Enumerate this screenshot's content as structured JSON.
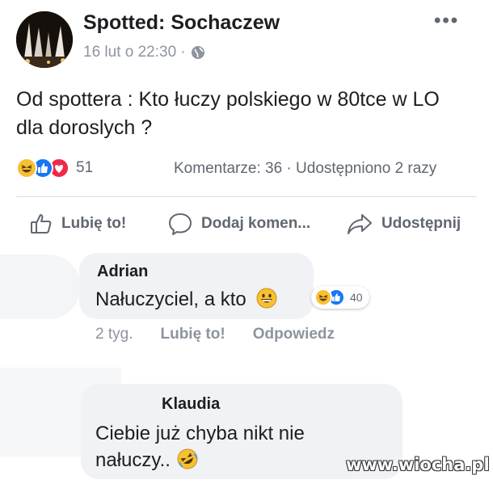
{
  "post": {
    "page_name": "Spotted: Sochaczew",
    "timestamp": "16 lut o 22:30 ·",
    "more_icon": "more-horizontal-icon",
    "text_line1": "Od spottera : Kto łuczy polskiego w 80tce w LO",
    "text_line2": "dla doroslych ?"
  },
  "reactions": {
    "count": "51",
    "comments": "Komentarze: 36",
    "separator": "·",
    "shares": "Udostępniono 2 razy"
  },
  "actions": {
    "like": "Lubię to!",
    "comment": "Dodaj komen...",
    "share": "Udostępnij"
  },
  "comments": [
    {
      "author": "Adrian",
      "text": "Nałuczyciel, a kto",
      "reaction_count": "40",
      "time": "2 tyg.",
      "like": "Lubię to!",
      "reply": "Odpowiedz"
    },
    {
      "author": "Klaudia",
      "text_line1": "Ciebie już chyba nikt nie",
      "text_line2": "nałuczy.."
    }
  ],
  "watermark": "www.wiocha.pl",
  "colors": {
    "text": "#1c1e21",
    "secondary": "#606770",
    "muted": "#8d949e",
    "like_blue": "#1877f2",
    "love_red": "#f0284a",
    "haha_yellow": "#f7c034"
  }
}
